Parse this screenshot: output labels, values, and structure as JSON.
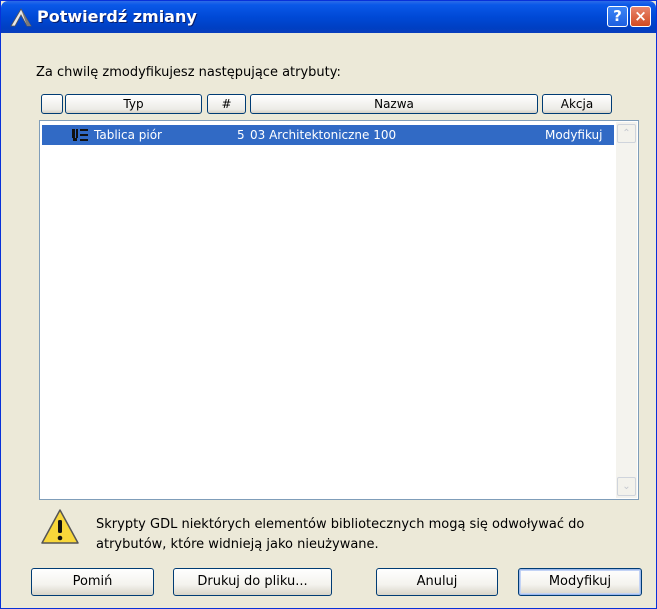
{
  "window": {
    "title": "Potwierdź zmiany",
    "help_glyph": "?",
    "close_glyph": "×",
    "icon": "archicad-logo-icon"
  },
  "prompt": "Za chwilę zmodyfikujesz następujące atrybuty:",
  "columns": {
    "checkbox": "",
    "type": "Typ",
    "number": "#",
    "name": "Nazwa",
    "action": "Akcja"
  },
  "rows": [
    {
      "type": "Tablica piór",
      "number": "5",
      "name": "03 Architektoniczne 100",
      "action": "Modyfikuj",
      "icon": "pen-set-icon",
      "selected": true
    }
  ],
  "scrollbar": {
    "up_glyph": "⌃",
    "down_glyph": "⌄"
  },
  "warning": {
    "icon": "warning-icon",
    "line1": "Skrypty GDL niektórych elementów bibliotecznych mogą się odwoływać do",
    "line2": "atrybutów, które widnieją jako nieużywane."
  },
  "buttons": {
    "skip": "Pomiń",
    "print": "Drukuj do pliku...",
    "cancel": "Anuluj",
    "modify": "Modyfikuj"
  },
  "colors": {
    "titlebar": "#0049d6",
    "selection": "#316ac5",
    "dialog_bg": "#ece9d8"
  }
}
